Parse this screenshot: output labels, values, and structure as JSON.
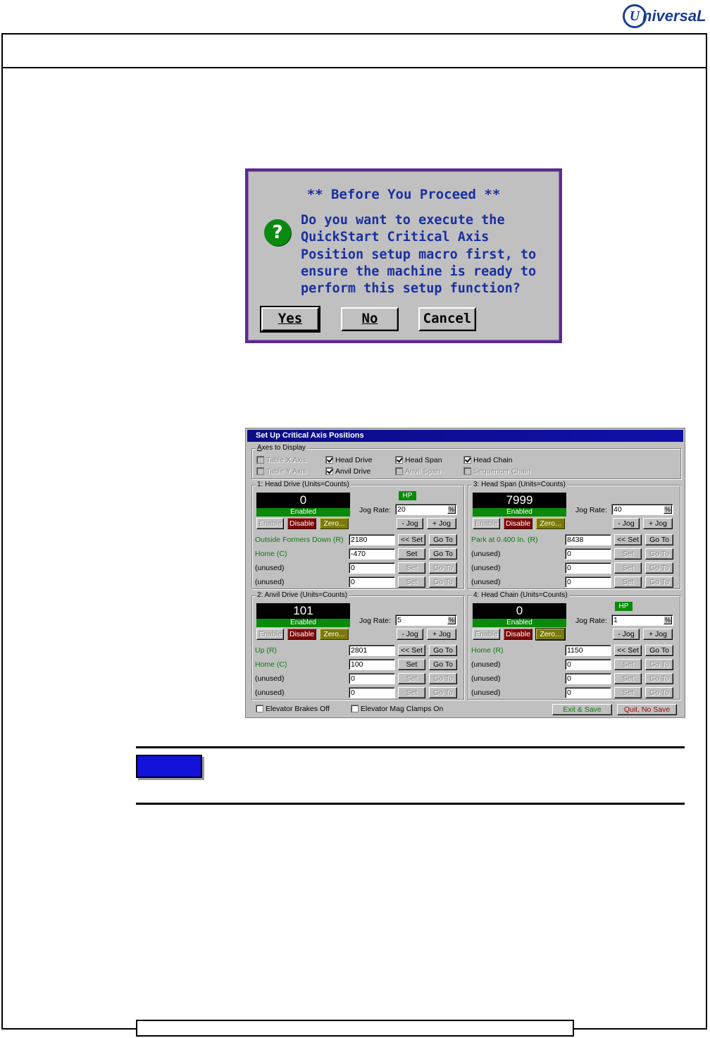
{
  "brand": {
    "logo_mark": "U",
    "logo_text": "niversaL"
  },
  "dialog1": {
    "title": "** Before You Proceed **",
    "icon": "question-icon",
    "message": "Do you want to execute the QuickStart Critical Axis Position setup macro first, to ensure the machine is ready to perform this setup function?",
    "buttons": [
      {
        "label": "Yes",
        "mnemonic_index": 0,
        "default": true
      },
      {
        "label": "No",
        "mnemonic_index": 0,
        "default": false
      },
      {
        "label": "Cancel",
        "mnemonic_index": -1,
        "default": false
      }
    ],
    "colors": {
      "text": "#1a2fa0",
      "border": "#5a2c8a",
      "icon": "#0a8a10"
    }
  },
  "dialog2": {
    "title": "Set Up Critical Axis Positions",
    "axes_group": {
      "label": "Axes to Display",
      "items": [
        {
          "label": "Table X Axis",
          "checked": false,
          "enabled": false
        },
        {
          "label": "Head Drive",
          "checked": true,
          "enabled": true
        },
        {
          "label": "Head Span",
          "checked": true,
          "enabled": true
        },
        {
          "label": "Head Chain",
          "checked": true,
          "enabled": true
        },
        {
          "label": "Table Y Axis",
          "checked": false,
          "enabled": false
        },
        {
          "label": "Anvil Drive",
          "checked": true,
          "enabled": true
        },
        {
          "label": "Anvil Span",
          "checked": false,
          "enabled": false
        },
        {
          "label": "Sequencer Chain",
          "checked": false,
          "enabled": false
        }
      ]
    },
    "common": {
      "enable": "Enable",
      "disable": "Disable",
      "zero": "Zero...",
      "jog_rate": "Jog Rate:",
      "jog_minus": "- Jog",
      "jog_plus": "+ Jog",
      "set_active": "<< Set",
      "set": "Set",
      "goto": "Go To",
      "hp": "HP",
      "spin": "%"
    },
    "panels": [
      {
        "title": "1: Head Drive (Units=Counts)",
        "position": "0",
        "status": "Enabled",
        "hp": true,
        "jog_rate": "20",
        "zero_focused": false,
        "rows": [
          {
            "label": "Outside Formers Down (R)",
            "value": "2180",
            "active": true,
            "green": true,
            "set_active": true
          },
          {
            "label": "Home (C)",
            "value": "-470",
            "active": true,
            "green": true,
            "set_active": false
          },
          {
            "label": "(unused)",
            "value": "0",
            "active": false,
            "green": false,
            "set_active": false
          },
          {
            "label": "(unused)",
            "value": "0",
            "active": false,
            "green": false,
            "set_active": false
          }
        ]
      },
      {
        "title": "3: Head Span (Units=Counts)",
        "position": "7999",
        "status": "Enabled",
        "hp": false,
        "jog_rate": "40",
        "zero_focused": false,
        "rows": [
          {
            "label": "Park at 0.400 In. (R)",
            "value": "8438",
            "active": true,
            "green": true,
            "set_active": true
          },
          {
            "label": "(unused)",
            "value": "0",
            "active": false,
            "green": false,
            "set_active": false
          },
          {
            "label": "(unused)",
            "value": "0",
            "active": false,
            "green": false,
            "set_active": false
          },
          {
            "label": "(unused)",
            "value": "0",
            "active": false,
            "green": false,
            "set_active": false
          }
        ]
      },
      {
        "title": "2: Anvil Drive (Units=Counts)",
        "position": "101",
        "status": "Enabled",
        "hp": false,
        "jog_rate": "5",
        "zero_focused": false,
        "rows": [
          {
            "label": "Up (R)",
            "value": "2801",
            "active": true,
            "green": true,
            "set_active": true
          },
          {
            "label": "Home (C)",
            "value": "100",
            "active": true,
            "green": true,
            "set_active": false
          },
          {
            "label": "(unused)",
            "value": "0",
            "active": false,
            "green": false,
            "set_active": false
          },
          {
            "label": "(unused)",
            "value": "0",
            "active": false,
            "green": false,
            "set_active": false
          }
        ]
      },
      {
        "title": "4: Head Chain (Units=Counts)",
        "position": "0",
        "status": "Enabled",
        "hp": true,
        "jog_rate": "1",
        "zero_focused": true,
        "rows": [
          {
            "label": "Home (R)",
            "value": "1150",
            "active": true,
            "green": true,
            "set_active": true
          },
          {
            "label": "(unused)",
            "value": "0",
            "active": false,
            "green": false,
            "set_active": false
          },
          {
            "label": "(unused)",
            "value": "0",
            "active": false,
            "green": false,
            "set_active": false
          },
          {
            "label": "(unused)",
            "value": "0",
            "active": false,
            "green": false,
            "set_active": false
          }
        ]
      }
    ],
    "bottom": {
      "brakes": "Elevator Brakes Off",
      "clamps": "Elevator Mag Clamps On",
      "exit": "Exit & Save",
      "quit": "Quit, No Save"
    }
  },
  "note_badge_color": "#1212d8"
}
